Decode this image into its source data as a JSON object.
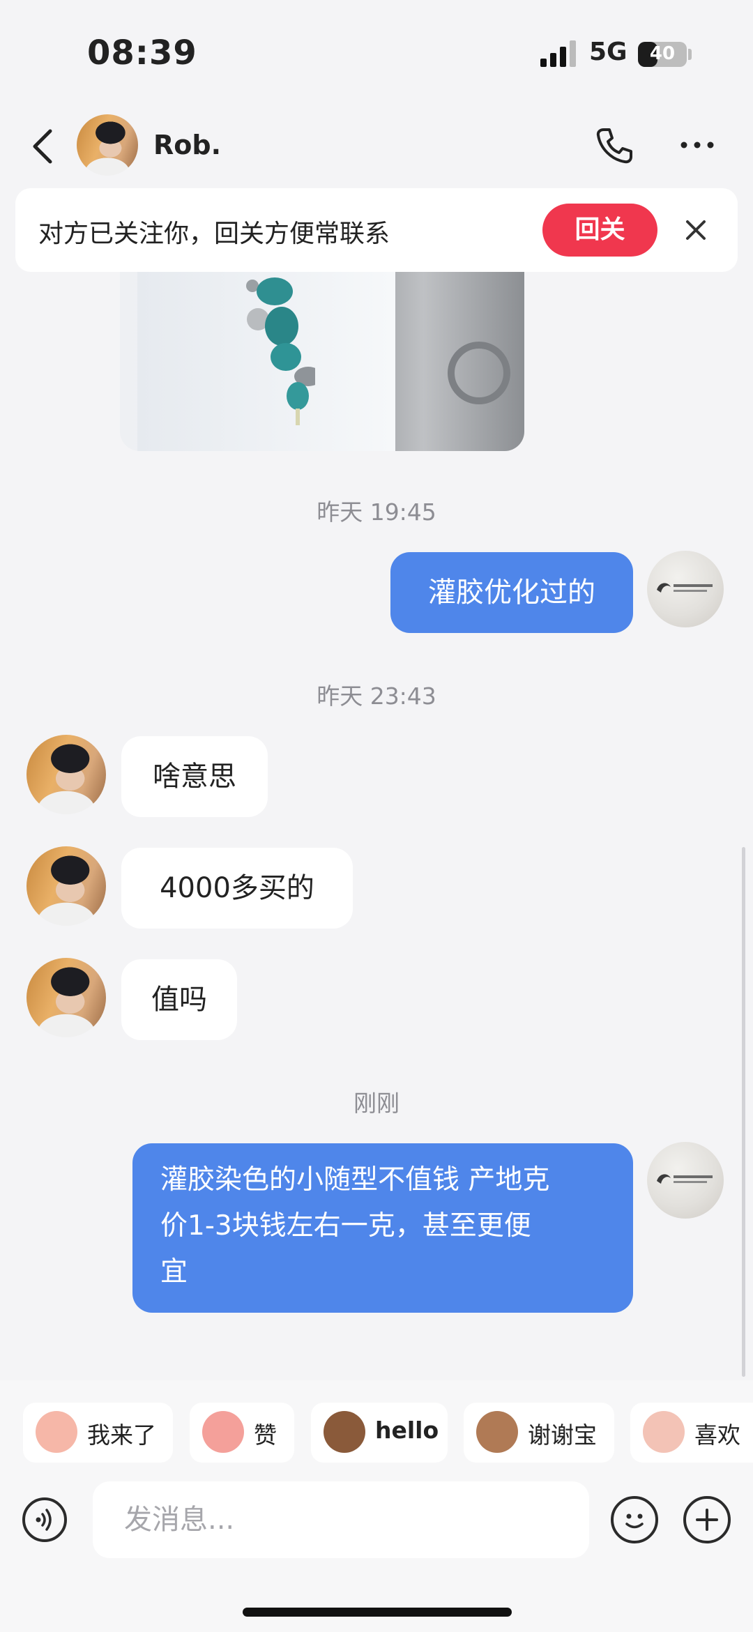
{
  "status_bar": {
    "time": "08:39",
    "network": "5G",
    "battery": "40",
    "battery_level": 0.4
  },
  "header": {
    "contact_name": "Rob."
  },
  "follow_banner": {
    "text": "对方已关注你，回关方便常联系",
    "button_label": "回关"
  },
  "conversation": {
    "timestamps": [
      "昨天 19:45",
      "昨天 23:43",
      "刚刚"
    ],
    "messages": [
      {
        "sender": "me",
        "text": "灌胶优化过的"
      },
      {
        "sender": "other",
        "text": "啥意思"
      },
      {
        "sender": "other",
        "text": "4000多买的"
      },
      {
        "sender": "other",
        "text": "值吗"
      },
      {
        "sender": "me",
        "lines": [
          "灌胶染色的小随型不值钱 产地克",
          "价1-3块钱左右一克，甚至更便",
          "宜"
        ]
      }
    ]
  },
  "quick_replies": [
    {
      "label": "我来了",
      "color": "#f6b7a8"
    },
    {
      "label": "赞",
      "color": "#f4a09a"
    },
    {
      "label": "hello",
      "color": "#8a5a3a"
    },
    {
      "label": "谢谢宝",
      "color": "#b07a55"
    },
    {
      "label": "喜欢",
      "color": "#f3c3b6"
    }
  ],
  "composer": {
    "placeholder": "发消息..."
  },
  "colors": {
    "accent_blue": "#4f86ea",
    "follow_red": "#f0374e"
  }
}
